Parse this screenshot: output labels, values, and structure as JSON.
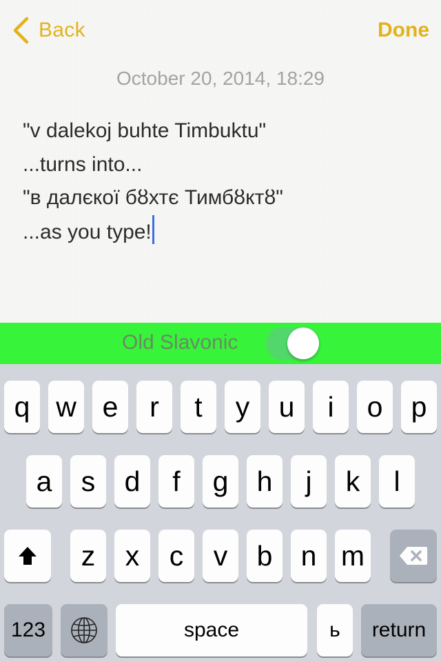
{
  "nav": {
    "back_label": "Back",
    "done_label": "Done"
  },
  "note": {
    "date": "October 20, 2014, 18:29",
    "lines": [
      "\"v dalekoj buhte Timbuktu\"",
      "...turns into...",
      "\"в далєкоï бȣхтє Тимбȣктȣ\"",
      "...as you type!"
    ]
  },
  "toggle": {
    "label": "Old Slavonic",
    "on": true
  },
  "keyboard": {
    "row1": [
      "q",
      "w",
      "e",
      "r",
      "t",
      "y",
      "u",
      "i",
      "o",
      "p"
    ],
    "row2": [
      "a",
      "s",
      "d",
      "f",
      "g",
      "h",
      "j",
      "k",
      "l"
    ],
    "row3": [
      "z",
      "x",
      "c",
      "v",
      "b",
      "n",
      "m"
    ],
    "numbers_label": "123",
    "space_label": "space",
    "extra_key": "ь",
    "return_label": "return"
  },
  "colors": {
    "accent": "#e2b319",
    "toggle_bar": "#37f43a",
    "switch_on": "#52d86a",
    "caret": "#3f6fe6",
    "keyboard_bg": "#d2d5db"
  },
  "icons": {
    "back": "chevron-left-icon",
    "shift": "shift-arrow-icon",
    "delete": "backspace-icon",
    "globe": "globe-icon"
  }
}
